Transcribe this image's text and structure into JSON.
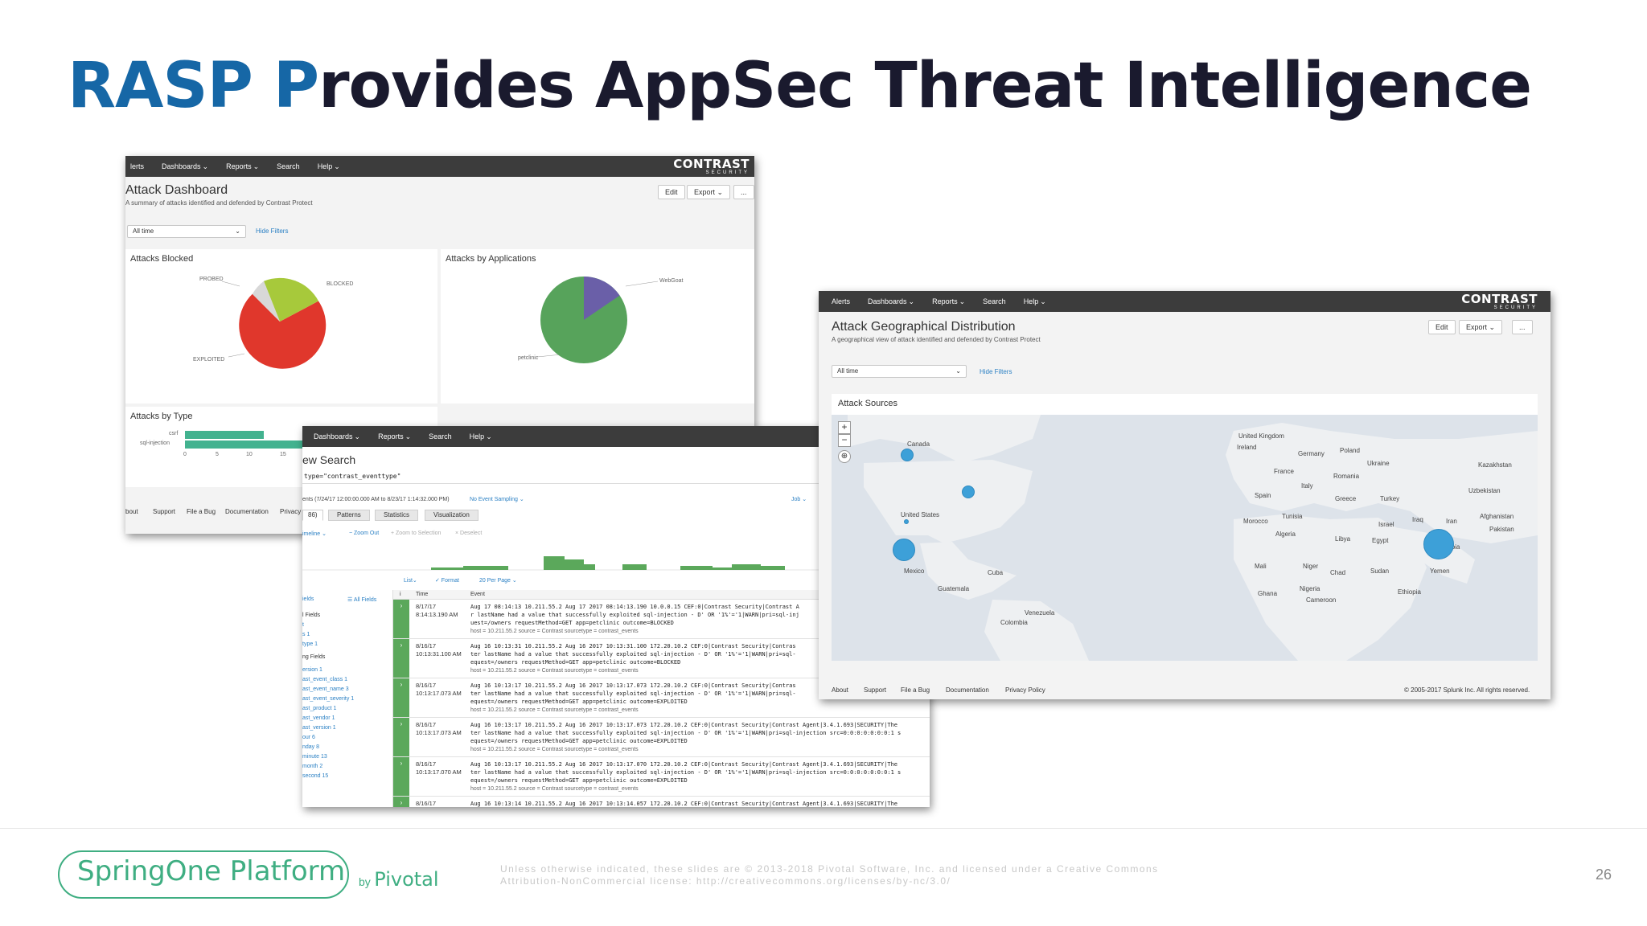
{
  "slide": {
    "title_accent": "RASP P",
    "title_rest": "rovides AppSec Threat Intelligence",
    "page_number": "26"
  },
  "brand": {
    "name": "CONTRAST",
    "tagline": "SECURITY"
  },
  "dashboard": {
    "nav": [
      "lerts",
      "Dashboards",
      "Reports",
      "Search",
      "Help"
    ],
    "title": "Attack Dashboard",
    "subtitle": "A summary of attacks identified and defended by Contrast Protect",
    "edit": "Edit",
    "export": "Export",
    "more": "...",
    "time_filter": "All time",
    "hide_filters": "Hide Filters",
    "panels": {
      "blocked_title": "Attacks Blocked",
      "blocked_labels": [
        "PROBED",
        "BLOCKED",
        "EXPLOITED"
      ],
      "apps_title": "Attacks by Applications",
      "apps_labels": [
        "WebGoat",
        "petclinic"
      ],
      "type_title": "Attacks by Type",
      "type_labels": [
        "csrf",
        "sql-injection"
      ],
      "type_ticks": [
        "0",
        "5",
        "10",
        "15"
      ]
    },
    "footer": [
      "bout",
      "Support",
      "File a Bug",
      "Documentation",
      "Privacy"
    ]
  },
  "search": {
    "nav": [
      "Dashboards",
      "Reports",
      "Search",
      "Help"
    ],
    "title": "ew Search",
    "query": "type=\"contrast_eventtype\"",
    "range": "ents (7/24/17 12:00:00.000 AM to 8/23/17 1:14:32.000 PM)",
    "sampling": "No Event Sampling",
    "job": "Job",
    "tabs": [
      "86)",
      "Patterns",
      "Statistics",
      "Visualization"
    ],
    "timeline": "imeline",
    "zoom_out": "− Zoom Out",
    "zoom_sel": "+ Zoom to Selection",
    "deselect": "× Deselect",
    "list": "List",
    "format": "✓ Format",
    "per_page": "20 Per Page",
    "fields_label": "ields",
    "all_fields": "☰ All Fields",
    "col_i": "i",
    "col_time": "Time",
    "col_event": "Event",
    "fields": [
      "l Fields",
      "t",
      "s 1",
      "type 1",
      "ng Fields",
      "ersion 1",
      "ast_event_class 1",
      "ast_event_name 3",
      "ast_event_severity 1",
      "ast_product 1",
      "ast_vendor 1",
      "ast_version 1",
      "our 6",
      "nday 8",
      "minute 13",
      "month 2",
      "second 15"
    ],
    "rows": [
      {
        "date": "8/17/17",
        "clock": "8:14:13.190 AM",
        "line1": "Aug 17 08:14:13 10.211.55.2 Aug 17 2017 08:14:13.190 10.0.0.15 CEF:0|Contrast Security|Contrast A",
        "line2": "r lastName had a value that successfully exploited sql-injection - D' OR '1%'='1|WARN|pri=sql-inj",
        "line3": "uest=/owners requestMethod=GET app=petclinic outcome=BLOCKED",
        "meta": "host = 10.211.55.2     source = Contrast     sourcetype = contrast_events"
      },
      {
        "date": "8/16/17",
        "clock": "10:13:31.100 AM",
        "line1": "Aug 16 10:13:31 10.211.55.2 Aug 16 2017 10:13:31.100 172.20.10.2 CEF:0|Contrast Security|Contras",
        "line2": "ter lastName had a value that successfully exploited sql-injection - D' OR '1%'='1|WARN|pri=sql-",
        "line3": "equest=/owners requestMethod=GET app=petclinic outcome=BLOCKED",
        "meta": "host = 10.211.55.2     source = Contrast     sourcetype = contrast_events"
      },
      {
        "date": "8/16/17",
        "clock": "10:13:17.073 AM",
        "line1": "Aug 16 10:13:17 10.211.55.2 Aug 16 2017 10:13:17.073 172.20.10.2 CEF:0|Contrast Security|Contras",
        "line2": "ter lastName had a value that successfully exploited sql-injection - D' OR '1%'='1|WARN|pri=sql-",
        "line3": "equest=/owners requestMethod=GET app=petclinic outcome=EXPLOITED",
        "meta": "host = 10.211.55.2     source = Contrast     sourcetype = contrast_events"
      },
      {
        "date": "8/16/17",
        "clock": "10:13:17.073 AM",
        "line1": "Aug 16 10:13:17 10.211.55.2 Aug 16 2017 10:13:17.073 172.20.10.2 CEF:0|Contrast Security|Contrast Agent|3.4.1.693|SECURITY|The",
        "line2": "ter lastName had a value that successfully exploited sql-injection - D' OR '1%'='1|WARN|pri=sql-injection src=0:0:0:0:0:0:0:1 s",
        "line3": "equest=/owners requestMethod=GET app=petclinic outcome=EXPLOITED",
        "meta": "host = 10.211.55.2     source = Contrast     sourcetype = contrast_events"
      },
      {
        "date": "8/16/17",
        "clock": "10:13:17.070 AM",
        "line1": "Aug 16 10:13:17 10.211.55.2 Aug 16 2017 10:13:17.070 172.20.10.2 CEF:0|Contrast Security|Contrast Agent|3.4.1.693|SECURITY|The",
        "line2": "ter lastName had a value that successfully exploited sql-injection - D' OR '1%'='1|WARN|pri=sql-injection src=0:0:0:0:0:0:0:1 s",
        "line3": "equest=/owners requestMethod=GET app=petclinic outcome=EXPLOITED",
        "meta": "host = 10.211.55.2     source = Contrast     sourcetype = contrast_events"
      },
      {
        "date": "8/16/17",
        "clock": "",
        "line1": "Aug 16 10:13:14 10.211.55.2 Aug 16 2017 10:13:14.057 172.20.10.2 CEF:0|Contrast Security|Contrast Agent|3.4.1.693|SECURITY|The",
        "line2": "",
        "line3": "",
        "meta": ""
      }
    ]
  },
  "geo": {
    "nav": [
      "Alerts",
      "Dashboards",
      "Reports",
      "Search",
      "Help"
    ],
    "title": "Attack Geographical Distribution",
    "subtitle": "A geographical view of attack identified and defended by Contrast Protect",
    "edit": "Edit",
    "export": "Export",
    "more": "...",
    "time_filter": "All time",
    "hide_filters": "Hide Filters",
    "panel_title": "Attack Sources",
    "countries": [
      "Canada",
      "United States",
      "Mexico",
      "Cuba",
      "Guatemala",
      "Venezuela",
      "Colombia",
      "United Kingdom",
      "Ireland",
      "Germany",
      "Poland",
      "Ukraine",
      "France",
      "Romania",
      "Kazakhstan",
      "Spain",
      "Italy",
      "Greece",
      "Turkey",
      "Uzbekistan",
      "Morocco",
      "Tunisia",
      "Israel",
      "Iraq",
      "Iran",
      "Afghanistan",
      "Pakistan",
      "Algeria",
      "Libya",
      "Egypt",
      "Saudi Arabia",
      "Mali",
      "Niger",
      "Chad",
      "Sudan",
      "Yemen",
      "Nigeria",
      "Ghana",
      "Cameroon",
      "Ethiopia"
    ],
    "footer_links": [
      "About",
      "Support",
      "File a Bug",
      "Documentation",
      "Privacy Policy"
    ],
    "copyright": "© 2005-2017 Splunk Inc. All rights reserved."
  },
  "footer": {
    "logo": "SpringOne Platform",
    "by": "by",
    "pivotal": "Pivotal",
    "license_line1": "Unless otherwise indicated, these slides are © 2013-2018 Pivotal Software, Inc. and licensed under a Creative Commons",
    "license_line2": "Attribution-NonCommercial license: http://creativecommons.org/licenses/by-nc/3.0/"
  },
  "colors": {
    "accent": "#1667a6",
    "brand_green": "#3fae82",
    "nav_bg": "#3c3c3c",
    "bar_green": "#5ba85b",
    "dot_blue": "#3da0d8"
  }
}
